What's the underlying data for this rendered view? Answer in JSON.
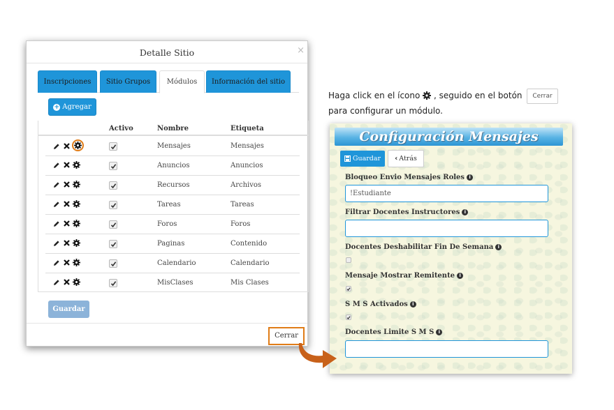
{
  "modal": {
    "title": "Detalle Sitio",
    "close_symbol": "×",
    "tabs": [
      {
        "label": "Inscripciones",
        "active": false
      },
      {
        "label": "Sitio Grupos",
        "active": false
      },
      {
        "label": "Módulos",
        "active": true
      },
      {
        "label": "Información del sitio",
        "active": false
      }
    ],
    "add_button": "Agregar",
    "table": {
      "headers": {
        "activo": "Activo",
        "nombre": "Nombre",
        "etiqueta": "Etiqueta"
      },
      "rows": [
        {
          "nombre": "Mensajes",
          "etiqueta": "Mensajes",
          "activo": true
        },
        {
          "nombre": "Anuncios",
          "etiqueta": "Anuncios",
          "activo": true
        },
        {
          "nombre": "Recursos",
          "etiqueta": "Archivos",
          "activo": true
        },
        {
          "nombre": "Tareas",
          "etiqueta": "Tareas",
          "activo": true
        },
        {
          "nombre": "Foros",
          "etiqueta": "Foros",
          "activo": true
        },
        {
          "nombre": "Paginas",
          "etiqueta": "Contenido",
          "activo": true
        },
        {
          "nombre": "Calendario",
          "etiqueta": "Calendario",
          "activo": true
        },
        {
          "nombre": "MisClases",
          "etiqueta": "Mis Clases",
          "activo": true
        }
      ]
    },
    "save_button": "Guardar",
    "close_button": "Cerrar"
  },
  "instruction": {
    "part1": "Haga click en el ícono",
    "part2": ", seguido en el botón",
    "button_label": "Cerrar",
    "part3": "para configurar un módulo."
  },
  "config": {
    "title": "Configuración Mensajes",
    "save_button": "Guardar",
    "back_button": "Atrás",
    "fields": {
      "bloqueo": {
        "label": "Bloqueo Envio Mensajes Roles",
        "value": "!Estudiante"
      },
      "filtrar": {
        "label": "Filtrar Docentes Instructores",
        "value": ""
      },
      "deshabilitar": {
        "label": "Docentes Deshabilitar Fin De Semana",
        "checked": false
      },
      "remitente": {
        "label": "Mensaje Mostrar Remitente",
        "checked": true
      },
      "sms": {
        "label": "S M S Activados",
        "checked": true
      },
      "limite": {
        "label": "Docentes Limite S M S",
        "value": ""
      }
    }
  },
  "colors": {
    "accent": "#1f95d9",
    "highlight": "#e07c17",
    "arrow": "#c8611a"
  }
}
